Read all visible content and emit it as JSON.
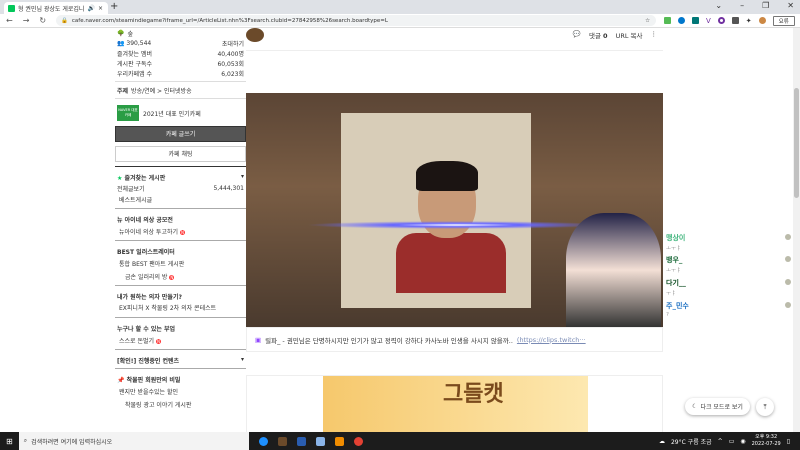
{
  "browser": {
    "tab_title": "형 권민님 광상도 게로깁니",
    "url": "cafe.naver.com/steamindiegame?iframe_url=/ArticleList.nhn%3Fsearch.clubid=27842958%26search.boardtype=L",
    "profile_label": "요류"
  },
  "sidebar": {
    "grade": "숲",
    "members": "390,544",
    "invite": "초대하기",
    "stats": [
      {
        "label": "즐겨찾는 멤버",
        "value": "40,400명"
      },
      {
        "label": "게시판 구독수",
        "value": "60,053회"
      },
      {
        "label": "우리카페앱 수",
        "value": "6,023회"
      }
    ],
    "topic_label": "주제",
    "topic": "방송/연예 > 인터넷방송",
    "award_badge": "NAVER 대표카페",
    "award": "2021년 대표 인기카페",
    "write_button": "카페 글쓰기",
    "chat_button": "카페 채팅",
    "favorites_title": "즐겨찾는 게시판",
    "all_posts": "전체글보기",
    "all_posts_count": "5,444,301",
    "best_posts": "베스트게시글",
    "sections": [
      {
        "title": "뉴 아이네 의상 공모전",
        "items": [
          "뉴아이네 의상 투고하기"
        ]
      },
      {
        "title": "BEST 일러스트레이터",
        "items": [
          "통합 BEST 팬아트 게시판",
          "금손 일러리의 방"
        ]
      },
      {
        "title": "내가 원하는 의자 만들기?",
        "items": [
          "EX피니처 X 착물링 2차 의자 콘테스트"
        ]
      },
      {
        "title": "누구나 할 수 있는 부업",
        "items": [
          "스스로 돈벌기"
        ]
      },
      {
        "title": "[확인!] 진행중인 컨텐츠",
        "items": []
      },
      {
        "title": "착물핀 회원만의 비밀",
        "items": [
          "왠지만 받을수있는 할인",
          "착물링 광고 이야기 게시판"
        ]
      }
    ]
  },
  "post": {
    "comments_label": "댓글",
    "comments_count": "0",
    "url_copy": "URL 복사",
    "caption": "릴파_ - 권민님은 단명하시지만 인기가 많고 정력이 강하다 카사노바 인생을 사시지 않을까..",
    "caption_link": "(https://clips.twitch···",
    "ad_text": "그들캣"
  },
  "chat": {
    "messages": [
      {
        "user": "맹상이",
        "text": "ㅗㅜㅑ",
        "color": "#3cb37a"
      },
      {
        "user": "뱅우_",
        "text": "ㅗㅜㅑ",
        "color": "#1e6b3c"
      },
      {
        "user": "다기__",
        "text": "ㅜㅑ",
        "color": "#0a4a1e"
      },
      {
        "user": "주_민수",
        "text": "?",
        "color": "#1b6fc2"
      }
    ]
  },
  "floating": {
    "dark_mode": "다크 모드로 보기"
  },
  "taskbar": {
    "search_placeholder": "검색하려면 여기에 입력하십시오",
    "weather": "29°C 구름 조금",
    "time": "오후 9:32",
    "date": "2022-07-29"
  }
}
